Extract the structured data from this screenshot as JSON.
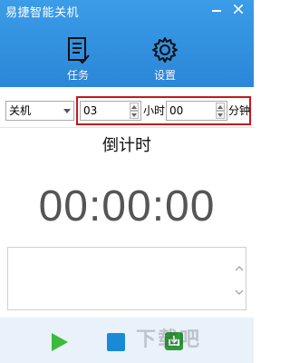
{
  "window": {
    "title": "易捷智能关机"
  },
  "toolbar": {
    "task_label": "任务",
    "settings_label": "设置"
  },
  "form": {
    "action_value": "关机",
    "hours_value": "03",
    "hours_unit": "小时",
    "minutes_value": "00",
    "minutes_unit": "分钟"
  },
  "countdown": {
    "label": "倒计时",
    "time": "00:00:00"
  },
  "watermark": {
    "text": "下载吧"
  },
  "colors": {
    "accent": "#2b87d8",
    "highlight_border": "#c8171e",
    "play": "#3cba3c",
    "stop": "#1a8ad8"
  }
}
